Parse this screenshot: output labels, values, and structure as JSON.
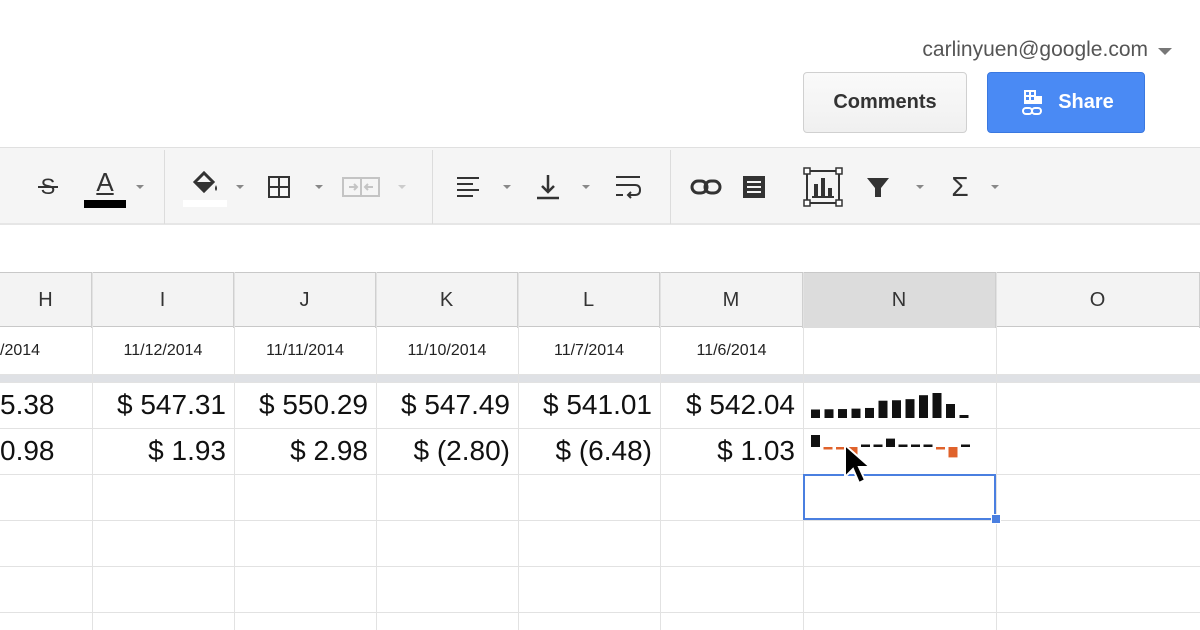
{
  "header": {
    "account_email": "carlinyuen@google.com",
    "comments_label": "Comments",
    "share_label": "Share"
  },
  "toolbar": {
    "icons": [
      "strikethrough-icon",
      "text-color-icon",
      "fill-color-icon",
      "borders-icon",
      "merge-cells-icon",
      "horizontal-align-icon",
      "vertical-align-icon",
      "text-wrap-icon",
      "insert-link-icon",
      "insert-comment-icon",
      "insert-chart-icon",
      "filter-icon",
      "functions-icon"
    ],
    "text_color_letter": "A",
    "functions_symbol": "Σ"
  },
  "colors": {
    "share_blue": "#4a8af4",
    "selection_blue": "#4a7fe0",
    "sparkline_bar": "#111111",
    "sparkline_negative": "#e0622b"
  },
  "sheet": {
    "columns": [
      "H",
      "I",
      "J",
      "K",
      "L",
      "M",
      "N",
      "O"
    ],
    "selected_column": "N",
    "dates": [
      "/2014",
      "11/12/2014",
      "11/11/2014",
      "11/10/2014",
      "11/7/2014",
      "11/6/2014",
      "",
      ""
    ],
    "prices": [
      "5.38",
      "$ 547.31",
      "$ 550.29",
      "$ 547.49",
      "$ 541.01",
      "$ 542.04",
      "",
      ""
    ],
    "changes": [
      "0.98",
      "$ 1.93",
      "$ 2.98",
      "$ (2.80)",
      "$ (6.48)",
      "$ 1.03",
      "",
      ""
    ],
    "sparkline_prices": [
      547.5,
      547.6,
      547.7,
      547.9,
      548.2,
      551.5,
      551.7,
      552.2,
      554.0,
      555.0,
      550.0,
      545.0
    ],
    "sparkline_changes": [
      3.0,
      -0.4,
      -0.5,
      -2.4,
      0.3,
      0.4,
      2.1,
      0.4,
      0.4,
      0.3,
      -0.6,
      -2.6,
      0.5
    ]
  }
}
